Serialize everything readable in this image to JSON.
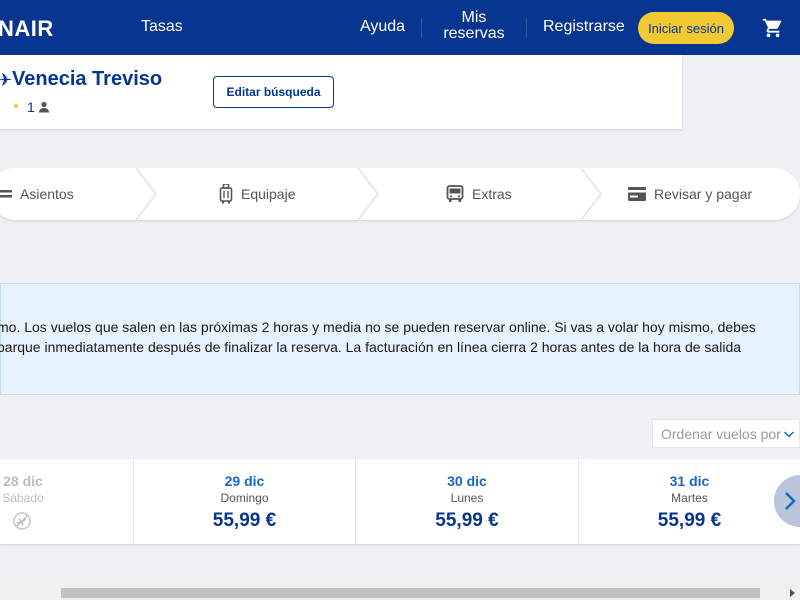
{
  "header": {
    "logo": "NAIR",
    "nav": {
      "tasas": "Tasas",
      "ayuda": "Ayuda",
      "mis_reservas": "Mis reservas",
      "registrarse": "Registrarse",
      "login": "Iniciar sesión"
    },
    "cart_icon": "shopping-cart-icon"
  },
  "summary": {
    "route": "Venecia Treviso",
    "passengers": "1",
    "edit_button": "Editar búsqueda"
  },
  "steps": [
    {
      "label": "Asientos",
      "icon": "seat-icon"
    },
    {
      "label": "Equipaje",
      "icon": "luggage-icon"
    },
    {
      "label": "Extras",
      "icon": "bus-icon"
    },
    {
      "label": "Revisar y pagar",
      "icon": "credit-card-icon"
    }
  ],
  "notice": {
    "line1": "mo. Los vuelos que salen en las próximas 2 horas y media no se pueden reservar online. Si vas a volar hoy mismo, debes",
    "line2": "barque inmediatamente después de finalizar la reserva. La facturación en línea cierra 2 horas antes de la hora de salida"
  },
  "sort": {
    "label": "Ordenar vuelos por"
  },
  "dates": [
    {
      "date": "28 dic",
      "weekday": "Sábado",
      "price": "",
      "available": false
    },
    {
      "date": "29 dic",
      "weekday": "Domingo",
      "price": "55,99 €",
      "available": true
    },
    {
      "date": "30 dic",
      "weekday": "Lunes",
      "price": "55,99 €",
      "available": true
    },
    {
      "date": "31 dic",
      "weekday": "Martes",
      "price": "55,99 €",
      "available": true
    }
  ],
  "colors": {
    "brand_blue": "#073590",
    "accent_yellow": "#f1c933",
    "link_blue": "#1666c7",
    "notice_bg": "#e6f3fc"
  }
}
